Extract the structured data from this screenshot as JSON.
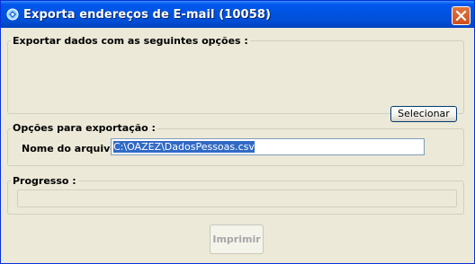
{
  "window": {
    "title": "Exporta endereços de E-mail (10058)"
  },
  "group_options": {
    "label": "Exportar dados com as seguintes opções :",
    "select_button": "Selecionar"
  },
  "group_export": {
    "label": "Opções para exportação :",
    "filename_label": "Nome do arquivo",
    "filename_value": "C:\\OAZEZ\\DadosPessoas.csv"
  },
  "group_progress": {
    "label": "Progresso :",
    "value": 0
  },
  "footer": {
    "print_button": "Imprimir"
  }
}
